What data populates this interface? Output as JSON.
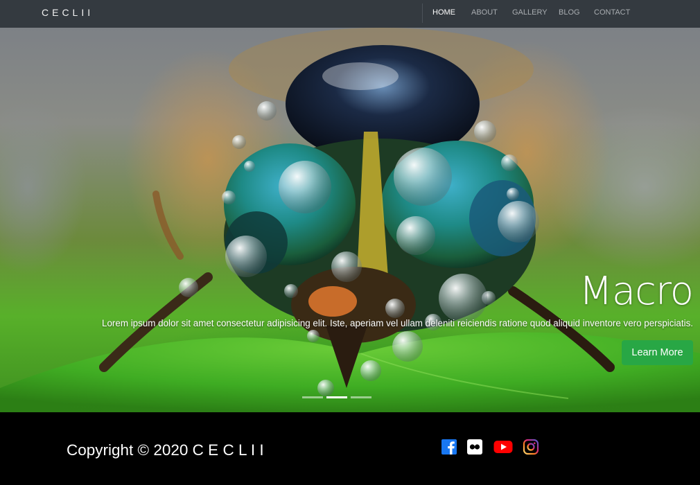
{
  "navbar": {
    "brand": "CECLII",
    "links": [
      {
        "label": "HOME",
        "active": true
      },
      {
        "label": "ABOUT",
        "active": false
      },
      {
        "label": "GALLERY",
        "active": false
      },
      {
        "label": "BLOG",
        "active": false
      },
      {
        "label": "CONTACT",
        "active": false
      }
    ]
  },
  "hero": {
    "title": "Macro",
    "text": "Lorem ipsum dolor sit amet consectetur adipisicing elit. Iste, aperiam vel ullam deleniti reiciendis ratione quod aliquid inventore vero perspiciatis.",
    "button_label": "Learn More",
    "slide_count": 3,
    "active_slide": 1
  },
  "footer": {
    "copyright": "Copyright © 2020 C E C L I I",
    "social": [
      {
        "name": "facebook-icon",
        "color": "#1877f2"
      },
      {
        "name": "flickr-icon",
        "color": "#ffffff"
      },
      {
        "name": "youtube-icon",
        "color": "#ff0000"
      },
      {
        "name": "instagram-icon",
        "color": "#c13584"
      }
    ]
  },
  "colors": {
    "navbar_bg": "#343a40",
    "button_bg": "#28a745",
    "footer_bg": "#000000"
  }
}
